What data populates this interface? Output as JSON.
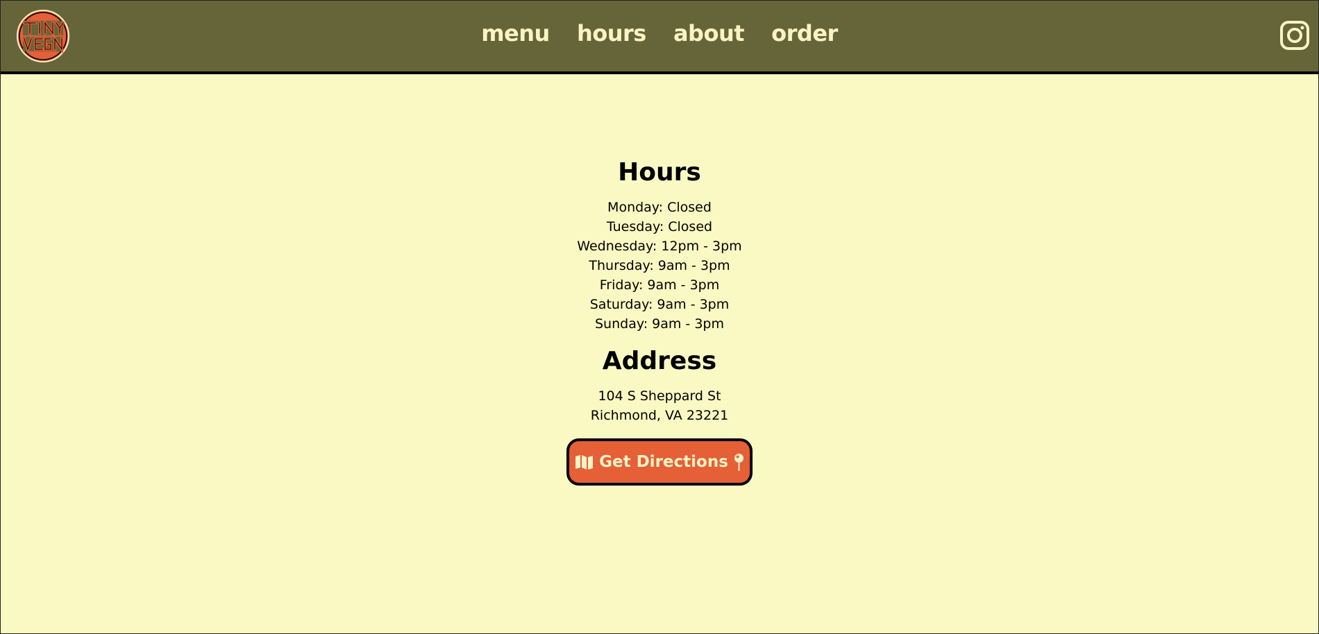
{
  "header": {
    "logo_text": "Tiny Vegan",
    "nav": [
      "menu",
      "hours",
      "about",
      "order"
    ],
    "social_icon": "instagram-icon"
  },
  "hours": {
    "title": "Hours",
    "days": [
      "Monday: Closed",
      "Tuesday: Closed",
      "Wednesday: 12pm - 3pm",
      "Thursday: 9am - 3pm",
      "Friday: 9am - 3pm",
      "Saturday: 9am - 3pm",
      "Sunday: 9am - 3pm"
    ]
  },
  "address": {
    "title": "Address",
    "line1": "104 S Sheppard St",
    "line2": "Richmond, VA 23221"
  },
  "directions_button": {
    "label": "Get Directions",
    "left_icon": "map-icon",
    "right_icon": "map-pin-icon"
  },
  "colors": {
    "header_bg": "#66653a",
    "page_bg": "#faf8c3",
    "accent": "#e55f37",
    "nav_text": "#fbf3c5"
  }
}
